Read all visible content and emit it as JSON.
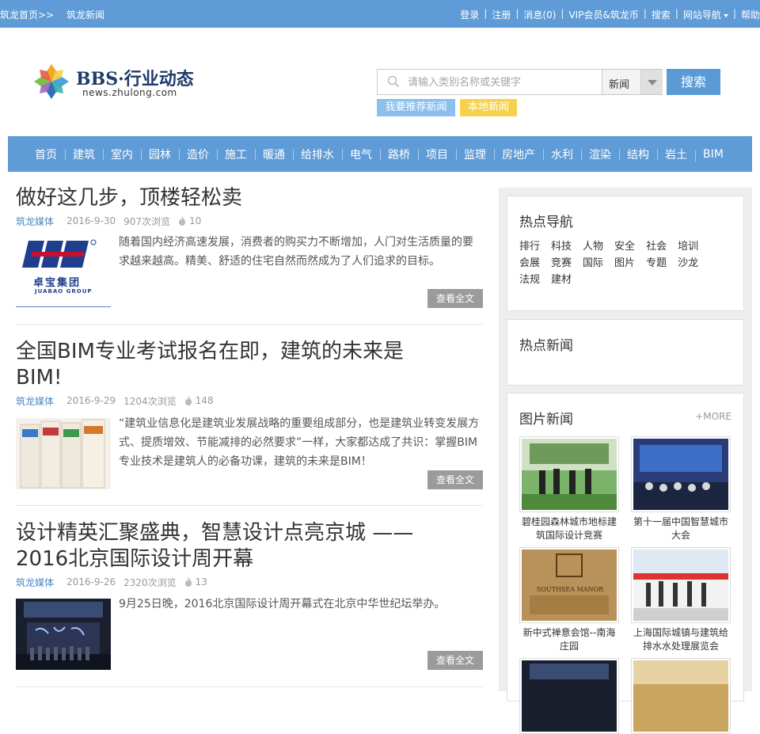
{
  "topbar": {
    "breadcrumb_home": "筑龙首页>>",
    "breadcrumb_current": "筑龙新闻",
    "links": [
      "登录",
      "注册",
      "消息(0)",
      "VIP会员&筑龙币",
      "搜索",
      "网站导航",
      "帮助"
    ]
  },
  "logo": {
    "title": "BBS·行业动态",
    "subtitle": "news.zhulong.com"
  },
  "search": {
    "placeholder": "请输入类别名称或关键字",
    "category": "新闻",
    "button": "搜索",
    "tag_recommend": "我要推荐新闻",
    "tag_local": "本地新闻"
  },
  "nav": [
    "首页",
    "建筑",
    "室内",
    "园林",
    "造价",
    "施工",
    "暖通",
    "给排水",
    "电气",
    "路桥",
    "项目",
    "监理",
    "房地产",
    "水利",
    "渲染",
    "结构",
    "岩土",
    "BIM"
  ],
  "articles": [
    {
      "title": "做好这几步，顶楼轻松卖",
      "source": "筑龙媒体",
      "date": "2016-9-30",
      "views": "907次浏览",
      "hot": "10",
      "summary": "随着国内经济高速发展，消费者的购买力不断增加，人门对生活质量的要求越来越高。精美、舒适的住宅自然而然成为了人们追求的目标。",
      "read_more": "查看全文",
      "thumb_text_cn": "卓宝集团",
      "thumb_text_en": "JUABAO GROUP"
    },
    {
      "title": "全国BIM专业考试报名在即，建筑的未来是BIM!",
      "source": "筑龙媒体",
      "date": "2016-9-29",
      "views": "1204次浏览",
      "hot": "148",
      "summary": "“建筑业信息化是建筑业发展战略的重要组成部分，也是建筑业转变发展方式、提质增效、节能减排的必然要求”一样，大家都达成了共识：掌握BIM专业技术是建筑人的必备功课，建筑的未来是BIM！",
      "read_more": "查看全文"
    },
    {
      "title": "设计精英汇聚盛典，智慧设计点亮京城 ——2016北京国际设计周开幕",
      "source": "筑龙媒体",
      "date": "2016-9-26",
      "views": "2320次浏览",
      "hot": "13",
      "summary": "9月25日晚，2016北京国际设计周开幕式在北京中华世纪坛举办。",
      "read_more": "查看全文"
    }
  ],
  "sidebar": {
    "hot_nav_title": "热点导航",
    "hot_nav_items": [
      "排行",
      "科技",
      "人物",
      "安全",
      "社会",
      "培训",
      "会展",
      "竞赛",
      "国际",
      "图片",
      "专题",
      "沙龙",
      "法规",
      "建材"
    ],
    "hot_news_title": "热点新闻",
    "pic_news_title": "图片新闻",
    "pic_more": "+MORE",
    "pics": [
      {
        "caption": "碧桂园森林城市地标建筑国际设计竞赛"
      },
      {
        "caption": "第十一届中国智慧城市大会"
      },
      {
        "caption": "新中式禅意会馆--南海庄园",
        "image_text": "SOUTHSEA MANOR"
      },
      {
        "caption": "上海国际城镇与建筑给排水水处理展览会"
      }
    ]
  },
  "colors": {
    "brand_blue": "#5f9bd6",
    "link_blue": "#4a86c6",
    "tag_yellow": "#f5d24e",
    "button_gray": "#9b9b9b"
  }
}
